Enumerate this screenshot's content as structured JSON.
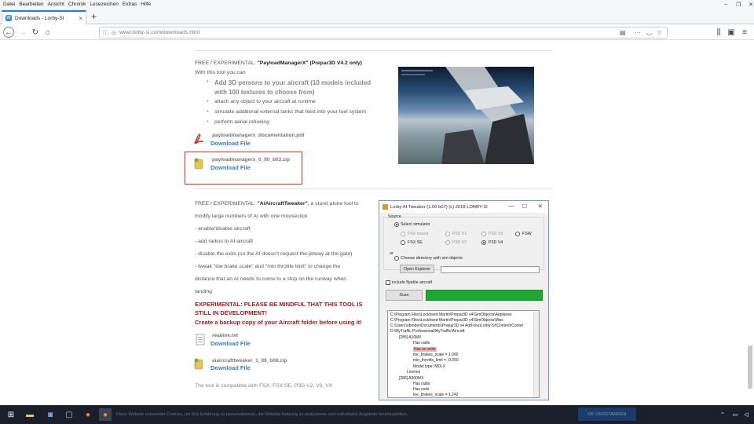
{
  "menubar": [
    "Datei",
    "Bearbeiten",
    "Ansicht",
    "Chronik",
    "Lesezeichen",
    "Extras",
    "Hilfe"
  ],
  "window_controls": {
    "minimize": "–",
    "maximize": "❐",
    "close": "✕"
  },
  "tab": {
    "title": "Downloads - Lorby-SI",
    "favicon_letter": "W",
    "close": "×"
  },
  "newtab": "+",
  "url": "www.lorby-si.com/downloads.html",
  "payload": {
    "heading_prefix": "FREE / EXPERIMENTAL: ",
    "heading_bold": "\"PayloadManagerX\" (Prepar3D V4.2 only)",
    "intro": "With this tool you can",
    "bullets": [
      "Add 3D persons to your aircraft (10 models included",
      "with 100 textures to choose from)",
      "attach any object to your aircraft at runtime",
      "simulate additional external tanks that feed into your fuel system",
      "perform aerial refueling"
    ],
    "file1_name": "payloadmanagerx_documentation.pdf",
    "file1_link": "Download File",
    "file2_name": "payloadmanagerx_0_90_b03.zip",
    "file2_link": "Download File"
  },
  "tweaker": {
    "heading_prefix": "FREE / EXPERIMENTAL: ",
    "heading_bold": "\"AiAircraftTweaker\"",
    "heading_suffix": ", a stand alone tool to",
    "lines": [
      "modify  large numbers of AI with one mouseclick",
      "- enable/disable aircraft",
      "- add radios to AI aircraft",
      "- disable the exits (so the AI doesn't request the jetway at the gate)",
      "- tweak \"toe brake scale\" and \"min throttle limit\" to change the",
      "distance that an AI needs to come to a stop on the runway when",
      "landing"
    ],
    "warn1": "EXPERIMENTAL: PLEASE BE MINDFUL THAT THIS TOOL IS",
    "warn2": "STILL IN DEVELOPMENT!",
    "warn3": "Create a backup copy of  your Aircraft folder before using it!",
    "file1_name": "readme.txt",
    "file1_link": "Download File",
    "file2_name": "aiaircrafttweaker_1_00_b08.zip",
    "file2_link": "Download File",
    "compat": "The tool is compatible with FSX, FSX:SE, P3D V2, V3, V4"
  },
  "app": {
    "title": "Lorby AI Tweaker (1.00 b07) (c) 2018 LORBY-SI",
    "source": "Source",
    "select_sim": "Select simulator",
    "sims": [
      "FSX boxed",
      "P3D V1",
      "P3D V3",
      "FSW",
      "FSX SE",
      "P3D V2",
      "P3D V4"
    ],
    "or": "or",
    "choose_dir": "Choose directory with sim objects",
    "open_explorer": "Open Explorer",
    "include_flyable": "include flyable aircraft",
    "scan": "Scan",
    "tree": [
      "C:\\Program Files\\Lockheed Martin\\Prepar3D v4\\SimObjects\\Airplanes",
      "C:\\Program Files\\Lockheed Martin\\Prepar3D v4\\SimObjects\\Misc",
      "C:\\Users\\obmder\\Documents\\Prepar3D v4 Add-ons\\Lorby-SI\\Content\\Conter",
      "D:\\MyTraffic Professional\\MyTraffic\\Aircraft",
      "[285] A10MX",
      "Has radio",
      "Has no exits",
      "toe_brakes_scale = 1.000",
      "min_throttle_limit = -0.250",
      "Model type: MDLX",
      "Liveries",
      "[286] A300MX",
      "Has radio",
      "Has exits",
      "toe_brakes_scale = 1.242"
    ]
  },
  "taskbar": {
    "notice": "Diese Website verwendet Cookies, um Ihre Erfahrung zu personalisieren, die Website-Nutzung zu analysieren und individuelle Angebote bereitzustellen.",
    "ok": "OK VERSTANDEN"
  }
}
